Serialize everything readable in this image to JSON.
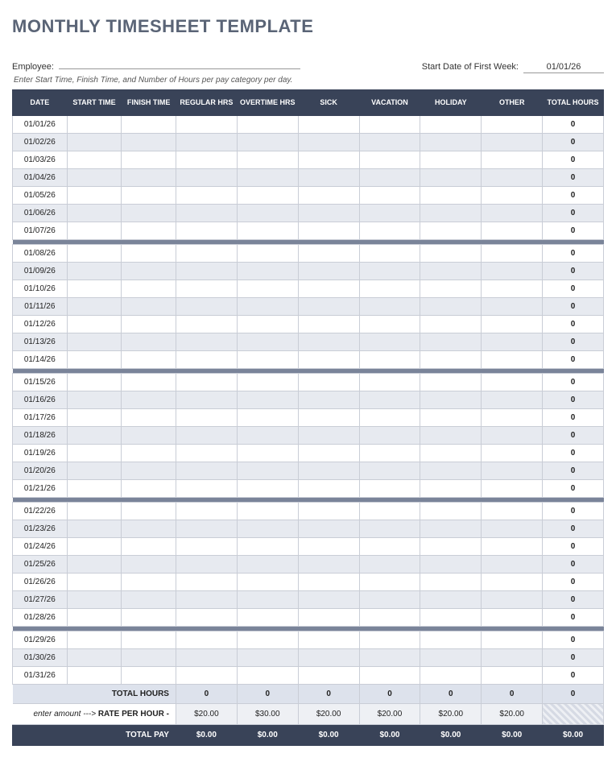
{
  "title": "MONTHLY TIMESHEET TEMPLATE",
  "meta": {
    "employee_label": "Employee:",
    "employee_value": "",
    "start_date_label": "Start Date of First Week:",
    "start_date_value": "01/01/26",
    "instruction": "Enter Start Time, Finish Time, and Number of Hours per pay category per day."
  },
  "columns": [
    "DATE",
    "START TIME",
    "FINISH TIME",
    "REGULAR HRS",
    "OVERTIME HRS",
    "SICK",
    "VACATION",
    "HOLIDAY",
    "OTHER",
    "TOTAL HOURS"
  ],
  "weeks": [
    {
      "dates": [
        "01/01/26",
        "01/02/26",
        "01/03/26",
        "01/04/26",
        "01/05/26",
        "01/06/26",
        "01/07/26"
      ]
    },
    {
      "dates": [
        "01/08/26",
        "01/09/26",
        "01/10/26",
        "01/11/26",
        "01/12/26",
        "01/13/26",
        "01/14/26"
      ]
    },
    {
      "dates": [
        "01/15/26",
        "01/16/26",
        "01/17/26",
        "01/18/26",
        "01/19/26",
        "01/20/26",
        "01/21/26"
      ]
    },
    {
      "dates": [
        "01/22/26",
        "01/23/26",
        "01/24/26",
        "01/25/26",
        "01/26/26",
        "01/27/26",
        "01/28/26"
      ]
    },
    {
      "dates": [
        "01/29/26",
        "01/30/26",
        "01/31/26"
      ]
    }
  ],
  "totals": {
    "total_hours_label": "TOTAL HOURS",
    "total_hours": [
      "0",
      "0",
      "0",
      "0",
      "0",
      "0",
      "0"
    ],
    "rate_prefix": "enter amount --->",
    "rate_label": "RATE PER HOUR -",
    "rates": [
      "$20.00",
      "$30.00",
      "$20.00",
      "$20.00",
      "$20.00",
      "$20.00"
    ],
    "total_pay_label": "TOTAL PAY",
    "total_pay": [
      "$0.00",
      "$0.00",
      "$0.00",
      "$0.00",
      "$0.00",
      "$0.00",
      "$0.00"
    ]
  },
  "row_total_default": "0"
}
